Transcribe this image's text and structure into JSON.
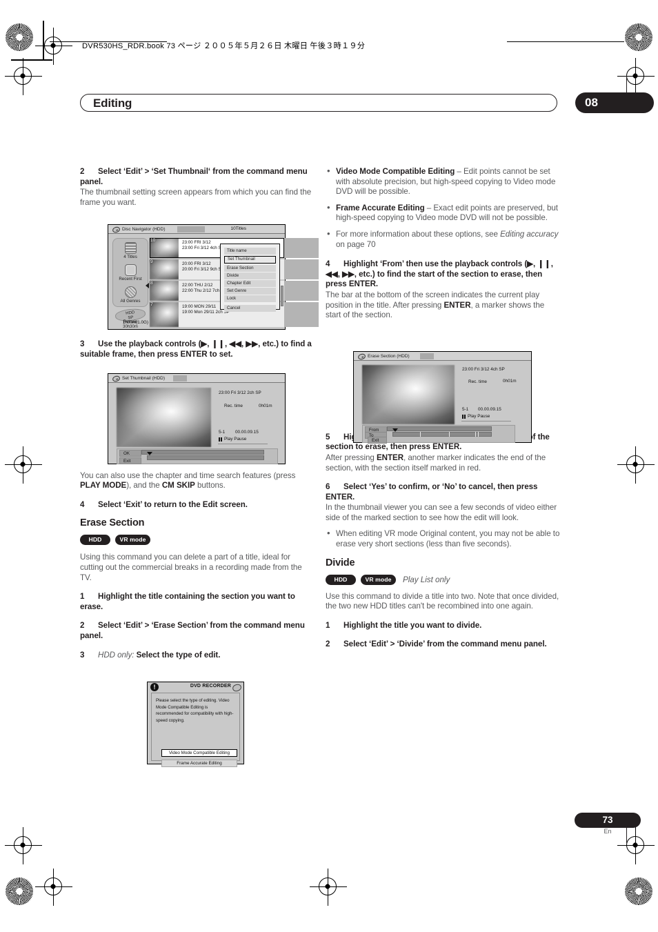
{
  "print_header": {
    "book_line": "DVR530HS_RDR.book  73 ページ  ２００５年５月２６日  木曜日  午後３時１９分"
  },
  "chapter": {
    "title": "Editing",
    "number": "08"
  },
  "footer": {
    "page_number": "73",
    "language": "En"
  },
  "left_column": {
    "step2": {
      "num": "2",
      "text": "Select ‘Edit’ > ‘Set Thumbnail‘ from the command menu panel.",
      "body": "The thumbnail setting screen appears from which you can find the frame you want."
    },
    "step3": {
      "num": "3",
      "text": "Use the playback controls (▶, ❙❙, ◀◀, ▶▶, etc.) to find a suitable frame, then press ENTER to set."
    },
    "note_after_3_a": "You can also use the chapter and time search features (press ",
    "note_after_3_b": "PLAY MODE",
    "note_after_3_c": "), and the ",
    "note_after_3_d": "CM SKIP",
    "note_after_3_e": " buttons.",
    "step4": {
      "num": "4",
      "text": "Select ‘Exit’ to return to the Edit screen."
    },
    "erase_section": {
      "heading": "Erase Section",
      "badge_hdd": "HDD",
      "badge_vr": "VR mode",
      "body": "Using this command you can delete a part of a title, ideal for cutting out the commercial breaks in a recording made from the TV.",
      "step1": {
        "num": "1",
        "text": "Highlight the title containing the section you want to erase."
      },
      "step2": {
        "num": "2",
        "text": "Select ‘Edit’ > ‘Erase Section’ from the command menu panel."
      },
      "step3": {
        "num": "3",
        "italic": "HDD only:",
        "text": "Select the type of edit."
      }
    }
  },
  "right_column": {
    "bullets_top": [
      {
        "bold": "Video Mode Compatible Editing",
        "text": " – Edit points cannot be set with absolute precision, but high-speed copying to Video mode DVD will be possible."
      },
      {
        "bold": "Frame Accurate Editing",
        "text": " – Exact edit points are preserved, but high-speed copying to Video mode DVD will not be possible."
      }
    ],
    "bullet_ref_pre": "For more information about these options, see ",
    "bullet_ref_italic": "Editing accuracy",
    "bullet_ref_post": " on page 70",
    "step4": {
      "num": "4",
      "text": "Highlight ‘From’ then use the playback controls (▶, ❙❙, ◀◀, ▶▶, etc.) to find the start of the section to erase, then press ENTER.",
      "body_a": "The bar at the bottom of the screen indicates the current play position in the title. After pressing ",
      "body_bold": "ENTER",
      "body_b": ", a marker shows the start of the section."
    },
    "step5": {
      "num": "5",
      "text": "Highlight ‘To’ then, in the same way, find the end of the section to erase, then press ENTER.",
      "body_a": "After pressing ",
      "body_bold": "ENTER",
      "body_b": ", another marker indicates the end of the section, with the section itself marked in red."
    },
    "step6": {
      "num": "6",
      "text": "Select ‘Yes’ to confirm, or ‘No’ to cancel, then press ENTER.",
      "body": "In the thumbnail viewer you can see a few seconds of video either side of the marked section to see how the edit will look.",
      "bullet": "When editing VR mode Original content, you may not be able to erase very short sections (less than five seconds)."
    },
    "divide": {
      "heading": "Divide",
      "badge_hdd": "HDD",
      "badge_vr": "VR mode",
      "badge_note": "Play List only",
      "body": "Use this command to divide a title into two. Note that once divided, the two new HDD titles can't be recombined into one again.",
      "step1": {
        "num": "1",
        "text": "Highlight the title you want to divide."
      },
      "step2": {
        "num": "2",
        "text": "Select ‘Edit’ > ‘Divide’ from the command menu panel."
      }
    }
  },
  "screenshots": {
    "navigator": {
      "titlebar": "Disc Navigator (HDD)",
      "titles_count": "10Titles",
      "sidebar": [
        {
          "label": "4 Titles",
          "icon": "list-icon"
        },
        {
          "label": "Recent First",
          "icon": "square-icon"
        },
        {
          "label": "All Genres",
          "icon": "genre-icon"
        }
      ],
      "hdd_badge_line1": "HDD",
      "hdd_badge_line2": "SP",
      "remain_line1": "Remain",
      "remain_line2": "30h30m",
      "rows": [
        {
          "num": "10",
          "line1": "23:00 FRI  3/12",
          "line2": "23:00 Fri  3/12  4ch  SP",
          "selected": true
        },
        {
          "num": "9",
          "line1": "20:00 FRI  3/12",
          "line2": "20:00 Fri  3/12  9ch  SP",
          "selected": false
        },
        {
          "num": "8",
          "line1": "22:00 THU  2/12",
          "line2": "22:00 Thu  2/12  7ch  SP",
          "selected": false
        },
        {
          "num": "7",
          "line1": "19:00 MON  29/11",
          "line2": "19:00 Mon  29/11  2ch  SP",
          "selected": false,
          "size": "1h00m(1.0G)"
        }
      ],
      "command_menu": [
        {
          "label": "Title name",
          "highlighted": false
        },
        {
          "label": "Set Thumbnail",
          "highlighted": true
        },
        {
          "label": "Erase Section",
          "highlighted": false
        },
        {
          "label": "Divide",
          "highlighted": false
        },
        {
          "label": "Chapter Edit",
          "highlighted": false
        },
        {
          "label": "Set Genre",
          "highlighted": false
        },
        {
          "label": "Lock",
          "highlighted": false
        },
        {
          "label": "Cancel",
          "highlighted": false
        }
      ]
    },
    "set_thumbnail": {
      "titlebar": "Set Thumbnail  (HDD)",
      "meta_line": "23:00 Fri 3/12   2ch   SP",
      "rec_label": "Rec. time",
      "rec_value": "0h01m",
      "chapter": "5-1",
      "timecode": "00.00.09.15",
      "transport": "Play Pause",
      "btn_ok": "OK",
      "btn_exit": "Exit"
    },
    "erase_section": {
      "titlebar": "Erase Section  (HDD)",
      "meta_line": "23:00  Fri  3/12  4ch  SP",
      "rec_label": "Rec. time",
      "rec_value": "0h01m",
      "chapter": "5-1",
      "timecode": "00.00.09.15",
      "transport": "Play Pause",
      "btn_from": "From",
      "btn_to": "To",
      "btn_exit": "Exit"
    },
    "dialog": {
      "title": "DVD RECORDER",
      "message": "Please select the type of editing. Video Mode Compatible Editing is recommended for compatibility with high-speed copying.",
      "btn_primary": "Video Mode Compatible Editing",
      "btn_secondary": "Frame Accurate Editing",
      "icon": "exclamation-icon"
    }
  }
}
